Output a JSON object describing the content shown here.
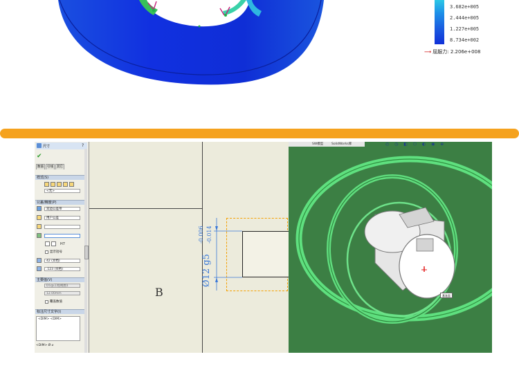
{
  "simulation": {
    "legend_values": [
      "3.682e+005",
      "2.444e+005",
      "1.227e+005",
      "8.734e+002"
    ],
    "yield_label": "屈服力: 2.206e+008",
    "colors": {
      "dark_blue": "#1026d8",
      "mid_blue": "#2a5ee8",
      "cyan": "#2cc7e6",
      "green": "#38c05a"
    }
  },
  "divider_color": "#f5a21e",
  "cad": {
    "property_manager": {
      "title": "尺寸",
      "tabs": [
        "数值",
        "引线",
        "其它"
      ],
      "sections": [
        {
          "header": "样式(S)",
          "fields": [
            "<无>"
          ]
        },
        {
          "header": "公差/精度(P)",
          "fields": [
            "双边公差带",
            "用户公差",
            "",
            "",
            "42 (文档)",
            ".123 (文档)"
          ],
          "fit_label": "H7",
          "check_label": "显示括号"
        },
        {
          "header": "主要值(V)",
          "fields": [
            "D1@工程视图1",
            "12.00mm"
          ]
        },
        {
          "header": "标注尺寸文字(I)",
          "fields": [
            "<DIM> <DIM>"
          ],
          "check_label": "覆盖数值"
        }
      ],
      "footer_icons": [
        "<DIM>",
        "Ø",
        "⌀"
      ]
    },
    "drawing_sheet": {
      "section_label": "B",
      "dimension_main": "Ø12  g5",
      "tolerance_upper": "-0.006",
      "tolerance_lower": "-0.014"
    },
    "viewport": {
      "toolbar_tabs": [
        "",
        "SW模型",
        "SolidWorks库"
      ],
      "tooltip": "基准面",
      "background_color": "#3c7f44"
    }
  }
}
